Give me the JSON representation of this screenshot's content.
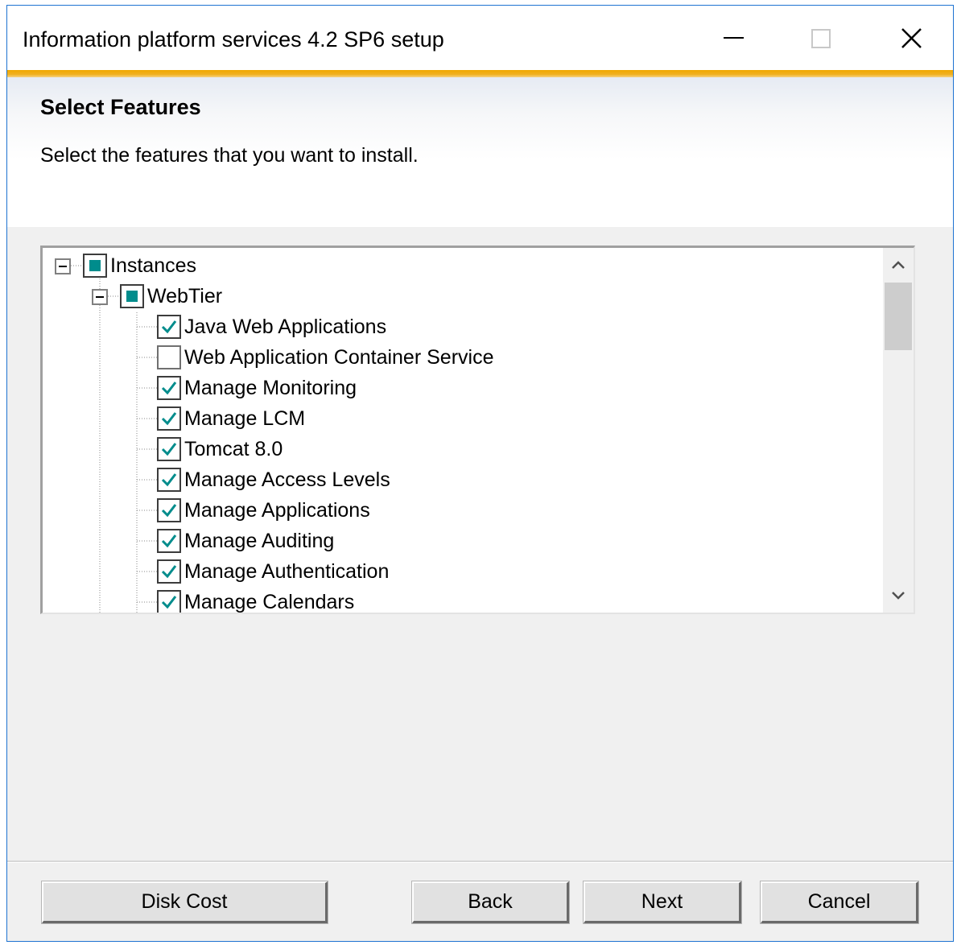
{
  "window": {
    "title": "Information platform services 4.2 SP6 setup",
    "controls": [
      "minimize-icon",
      "maximize-icon",
      "close-icon"
    ],
    "accent_color": "#f0a800"
  },
  "header": {
    "heading": "Select Features",
    "subheading": "Select the features that you want to install."
  },
  "tree": {
    "root": {
      "label": "Instances",
      "state": "partial",
      "expanded": true
    },
    "group": {
      "label": "WebTier",
      "state": "partial",
      "expanded": true
    },
    "items": [
      {
        "label": "Java Web Applications",
        "checked": true
      },
      {
        "label": "Web Application Container Service",
        "checked": false
      },
      {
        "label": "Manage Monitoring",
        "checked": true
      },
      {
        "label": "Manage LCM",
        "checked": true
      },
      {
        "label": "Tomcat 8.0",
        "checked": true
      },
      {
        "label": "Manage Access Levels",
        "checked": true
      },
      {
        "label": "Manage Applications",
        "checked": true
      },
      {
        "label": "Manage Auditing",
        "checked": true
      },
      {
        "label": "Manage Authentication",
        "checked": true
      },
      {
        "label": "Manage Calendars",
        "checked": true
      }
    ],
    "check_color": "#008c8c"
  },
  "buttons": {
    "disk_cost": "Disk Cost",
    "back": "Back",
    "next": "Next",
    "cancel": "Cancel"
  }
}
